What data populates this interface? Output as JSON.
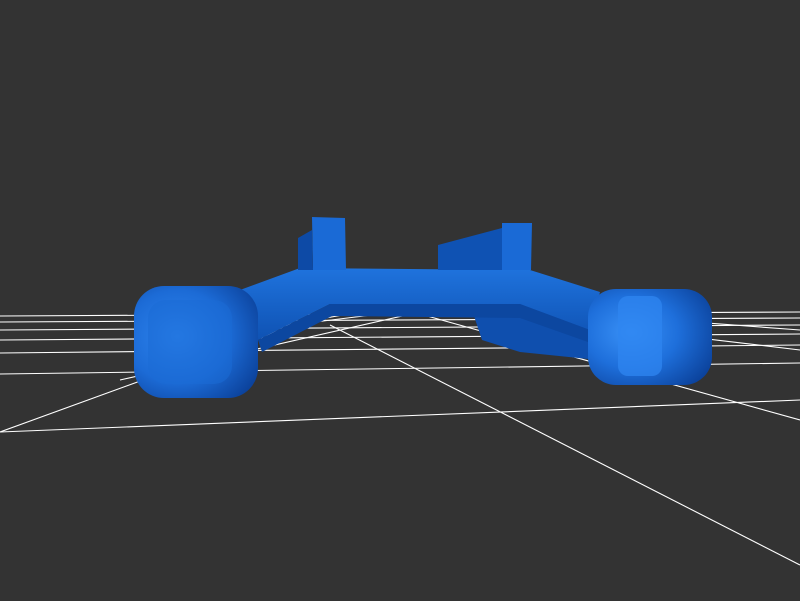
{
  "scene": {
    "background_color": "#333333",
    "grid_color": "#ffffff",
    "model_color": "#1a66cc",
    "model_highlight_color": "#2f86f0",
    "model_shadow_color": "#0c47a0"
  }
}
